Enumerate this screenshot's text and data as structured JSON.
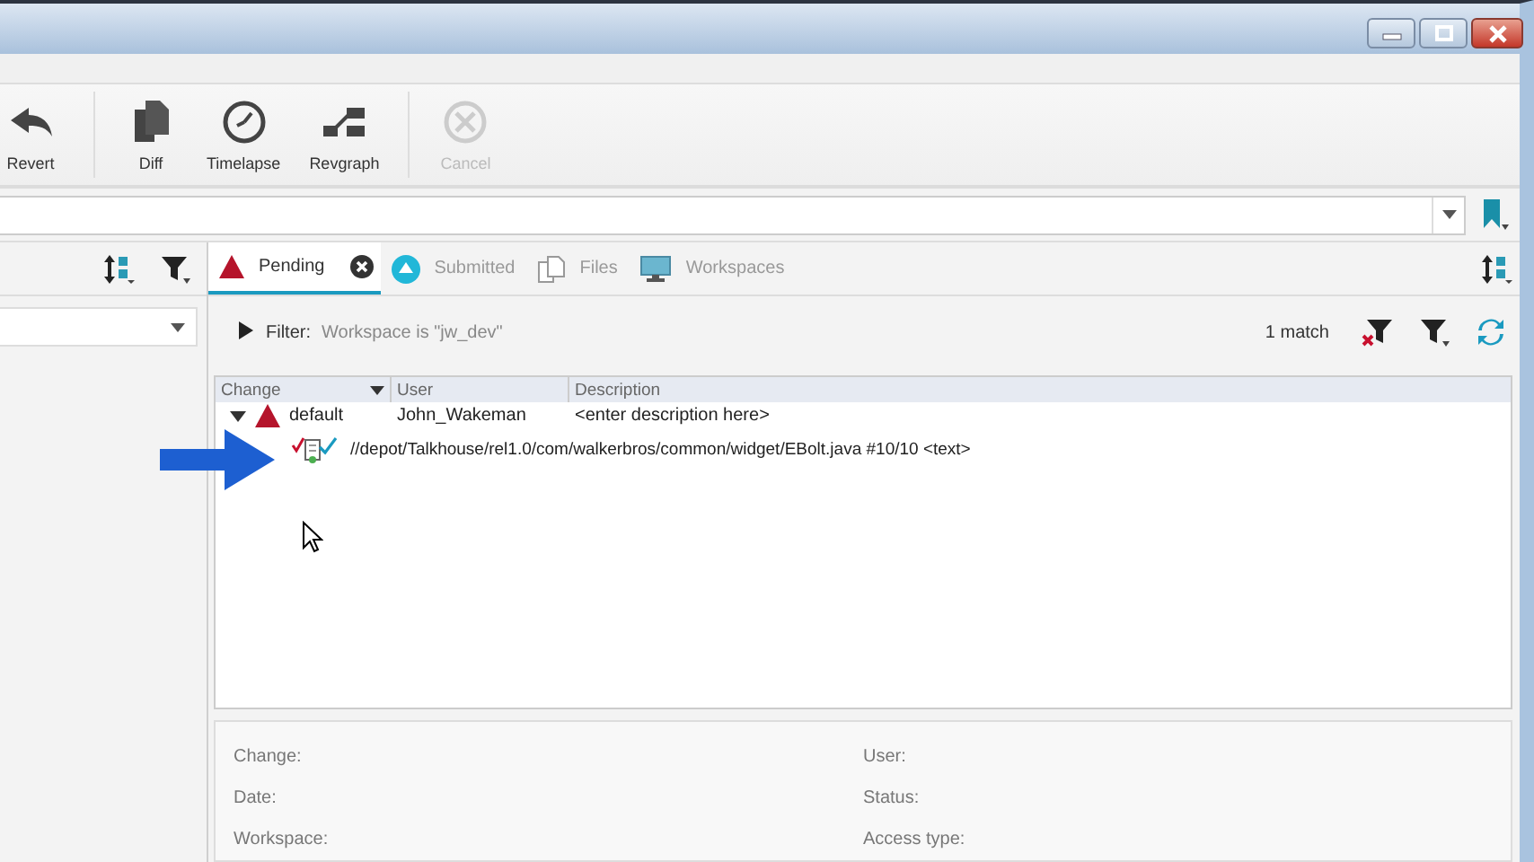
{
  "toolbar": {
    "buttons": [
      {
        "label": "Revert",
        "kind": "revert",
        "disabled": false
      },
      {
        "label": "Diff",
        "kind": "diff",
        "disabled": false
      },
      {
        "label": "Timelapse",
        "kind": "timelapse",
        "disabled": false
      },
      {
        "label": "Revgraph",
        "kind": "revgraph",
        "disabled": false
      },
      {
        "label": "Cancel",
        "kind": "cancel",
        "disabled": true
      }
    ]
  },
  "tabs": [
    {
      "label": "Pending",
      "kind": "pending",
      "selected": true,
      "closable": true
    },
    {
      "label": "Submitted",
      "kind": "submitted",
      "selected": false,
      "closable": false
    },
    {
      "label": "Files",
      "kind": "files",
      "selected": false,
      "closable": false
    },
    {
      "label": "Workspaces",
      "kind": "workspaces",
      "selected": false,
      "closable": false
    }
  ],
  "filter": {
    "label": "Filter:",
    "value": "Workspace is \"jw_dev\"",
    "expanded": false,
    "match_count": "1 match"
  },
  "table": {
    "columns": [
      "Change",
      "User",
      "Description"
    ],
    "rows": [
      {
        "change": "default",
        "user": "John_Wakeman",
        "description": "<enter description here>",
        "expanded": true,
        "children": [
          {
            "path": "//depot/Talkhouse/rel1.0/com/walkerbros/common/widget/EBolt.java #10/10 <text>"
          }
        ]
      }
    ]
  },
  "details": {
    "left": [
      "Change:",
      "Date:",
      "Workspace:"
    ],
    "right": [
      "User:",
      "Status:",
      "Access type:"
    ]
  }
}
